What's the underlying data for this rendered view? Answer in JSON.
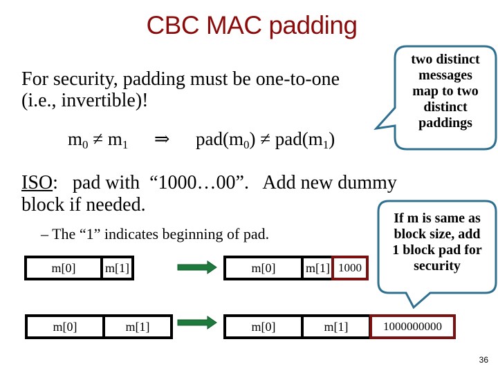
{
  "slide": {
    "title": "CBC MAC padding",
    "page_number": "36"
  },
  "intro": {
    "line1": "For security, padding must be one-to-one",
    "line2": "(i.e., invertible)!"
  },
  "formula": {
    "m": "m",
    "sub0": "0",
    "sub1": "1",
    "neq": "≠",
    "implies": "⇒",
    "pad_open": "pad(m",
    "close": ")"
  },
  "iso": {
    "label": "ISO",
    "line1_rest": ":   pad with  “1000…00”.   Add new dummy",
    "line2": "block if needed.",
    "bullet": "–",
    "sub_point": "The “1” indicates beginning of pad."
  },
  "diagram": {
    "row1": {
      "input_blocks": [
        "m[0]",
        "m[1]"
      ],
      "output_blocks": [
        "m[0]",
        "m[1]"
      ],
      "pad": "1000"
    },
    "row2": {
      "input_blocks": [
        "m[0]",
        "m[1]"
      ],
      "output_blocks": [
        "m[0]",
        "m[1]"
      ],
      "pad": "1000000000"
    },
    "colors": {
      "arrow": "#1e7a3c",
      "pad_border": "#7a1010",
      "block_border": "#000000"
    }
  },
  "callouts": [
    {
      "text_lines": [
        "two distinct",
        "messages",
        "map to two",
        "distinct",
        "paddings"
      ]
    },
    {
      "text_lines": [
        "If m is same as",
        "block size, add",
        "1 block pad for",
        "security"
      ]
    }
  ],
  "colors": {
    "title": "#8b0a0a",
    "callout_border": "#2f6f8f"
  }
}
